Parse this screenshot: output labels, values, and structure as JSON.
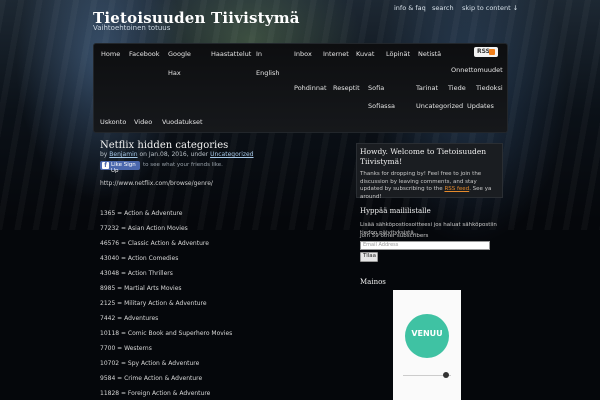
{
  "site": {
    "title": "Tietoisuuden Tiivistymä",
    "tagline": "Vaihtoehtoinen totuus"
  },
  "top_links": [
    "info & faq",
    "search",
    "skip to content ↓"
  ],
  "nav": {
    "items": [
      "Home",
      "Facebook",
      "Google",
      "Hax",
      "Haastattelut",
      "In",
      "English",
      "Inbox",
      "Internet",
      "Kuvat",
      "Löpinät",
      "Netistä",
      "Onnettomuudet",
      "Pohdinnat",
      "Reseptit",
      "Sofia",
      "Sofiassa",
      "Tarinat",
      "Tiede",
      "Tiedoksi",
      "Uncategorized",
      "Updates"
    ],
    "rss_label": "RSS",
    "sub_items": [
      "Uskonto",
      "Video",
      "Vuodatukset"
    ]
  },
  "post": {
    "title": "Netflix hidden categories",
    "by": "by",
    "author": "Benjamin",
    "on": "on Jan.08, 2016, under",
    "category": "Uncategorized",
    "like_label": "Like",
    "signup_label": "Sign Up",
    "like_text": "to see what your friends like.",
    "url": "http://www.netflix.com/browse/genre/",
    "categories": [
      "1365 = Action & Adventure",
      "77232 = Asian Action Movies",
      "46576 = Classic Action & Adventure",
      "43040 = Action Comedies",
      "43048 = Action Thrillers",
      "8985 = Martial Arts Movies",
      "2125 = Military Action & Adventure",
      "7442 = Adventures",
      "10118 = Comic Book and Superhero Movies",
      "7700 = Westerns",
      "10702 = Spy Action & Adventure",
      "9584 = Crime Action & Adventure",
      "11828 = Foreign Action & Adventure"
    ]
  },
  "sidebar": {
    "welcome_title": "Howdy. Welcome to Tietoisuuden Tiivistymä!",
    "welcome_body_1": "Thanks for dropping by! Feel free to join the discussion by leaving comments, and stay updated by subscribing to the",
    "welcome_rss": "RSS feed",
    "welcome_body_2": ". See ya around!",
    "mail_title": "Hyppää maililistalle",
    "mail_text": "Lisää sähköpostiosoitteesi jos haluat sähköpostiin tiedon päivityksistä.",
    "subscribers": "Join 59 other subscribers",
    "email_placeholder": "Email Address",
    "subscribe_button": "Tilaa",
    "ads_title": "Mainos",
    "ad_logo": "VENUU"
  }
}
